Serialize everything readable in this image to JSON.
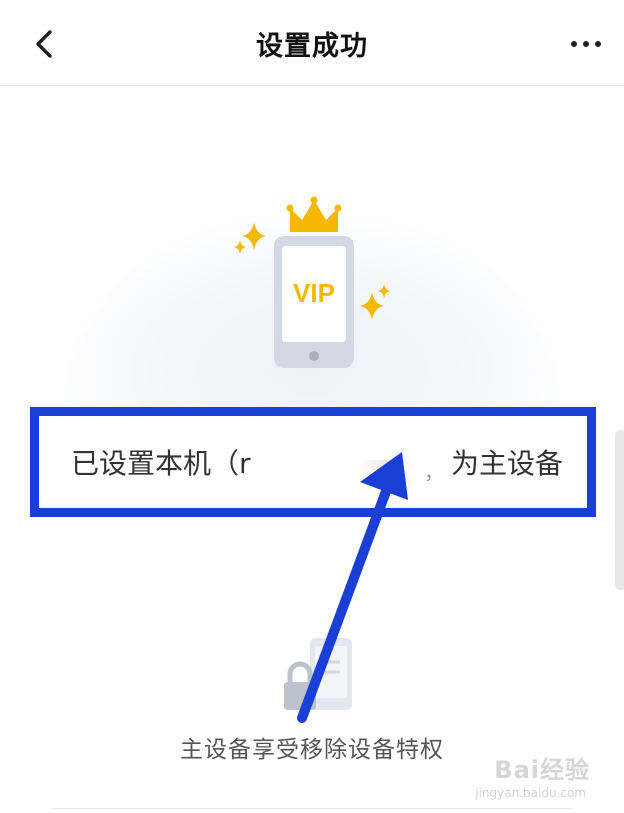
{
  "header": {
    "title": "设置成功",
    "back_icon": "chevron-left-icon",
    "more_icon": "more-horizontal-icon"
  },
  "hero": {
    "badge_text": "VIP",
    "colors": {
      "crown": "#f6b800",
      "sparkle": "#f6b800",
      "phone_body": "#d4d8e4",
      "screen": "#ffffff",
      "vip": "#f6b800"
    }
  },
  "info": {
    "prefix": "已设置本机（r",
    "suffix": "为主设备",
    "separator": "，"
  },
  "privilege": {
    "text": "主设备享受移除设备特权"
  },
  "annotation": {
    "frame_color": "#1a3fd6",
    "arrow_color": "#1a3fd6"
  },
  "watermark": {
    "brand": "Bai经验",
    "site": "jingyan.baidu.com"
  }
}
